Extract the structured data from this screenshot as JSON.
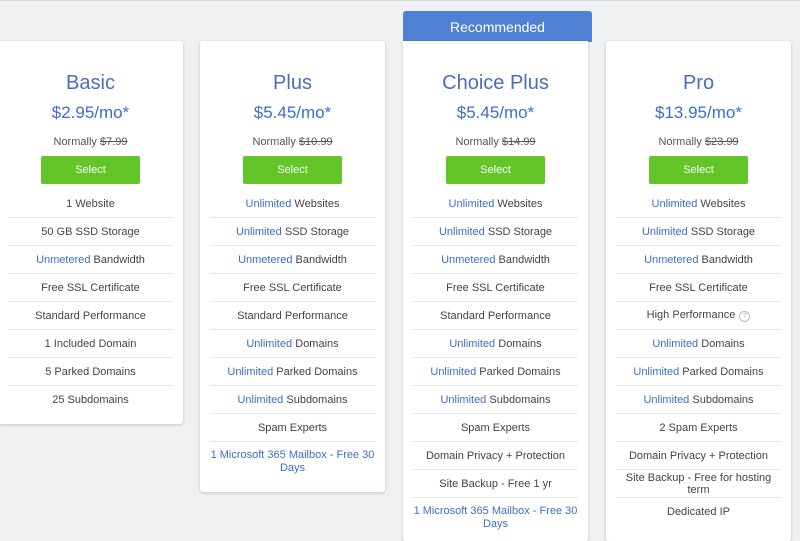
{
  "recommended_label": "Recommended",
  "plans": [
    {
      "name": "Basic",
      "price": "$2.95/mo*",
      "normally_label": "Normally",
      "normally_price": "$7.99",
      "select_label": "Select",
      "features": [
        {
          "hl": "",
          "text": "1 Website"
        },
        {
          "hl": "",
          "text": "50 GB SSD Storage"
        },
        {
          "hl": "Unmetered",
          "text": " Bandwidth"
        },
        {
          "hl": "",
          "text": "Free SSL Certificate"
        },
        {
          "hl": "",
          "text": "Standard Performance"
        },
        {
          "hl": "",
          "text": "1 Included Domain"
        },
        {
          "hl": "",
          "text": "5 Parked Domains"
        },
        {
          "hl": "",
          "text": "25 Subdomains"
        }
      ]
    },
    {
      "name": "Plus",
      "price": "$5.45/mo*",
      "normally_label": "Normally",
      "normally_price": "$10.99",
      "select_label": "Select",
      "features": [
        {
          "hl": "Unlimited",
          "text": " Websites"
        },
        {
          "hl": "Unlimited",
          "text": " SSD Storage"
        },
        {
          "hl": "Unmetered",
          "text": " Bandwidth"
        },
        {
          "hl": "",
          "text": "Free SSL Certificate"
        },
        {
          "hl": "",
          "text": "Standard Performance"
        },
        {
          "hl": "Unlimited",
          "text": " Domains"
        },
        {
          "hl": "Unlimited",
          "text": " Parked Domains"
        },
        {
          "hl": "Unlimited",
          "text": " Subdomains"
        },
        {
          "hl": "",
          "text": "Spam Experts"
        },
        {
          "hl": "1 Microsoft 365 Mailbox - Free 30 Days",
          "text": ""
        }
      ]
    },
    {
      "name": "Choice Plus",
      "price": "$5.45/mo*",
      "normally_label": "Normally",
      "normally_price": "$14.99",
      "select_label": "Select",
      "features": [
        {
          "hl": "Unlimited",
          "text": " Websites"
        },
        {
          "hl": "Unlimited",
          "text": " SSD Storage"
        },
        {
          "hl": "Unmetered",
          "text": " Bandwidth"
        },
        {
          "hl": "",
          "text": "Free SSL Certificate"
        },
        {
          "hl": "",
          "text": "Standard Performance"
        },
        {
          "hl": "Unlimited",
          "text": " Domains"
        },
        {
          "hl": "Unlimited",
          "text": " Parked Domains"
        },
        {
          "hl": "Unlimited",
          "text": " Subdomains"
        },
        {
          "hl": "",
          "text": "Spam Experts"
        },
        {
          "hl": "",
          "text": "Domain Privacy + Protection"
        },
        {
          "hl": "",
          "text": "Site Backup - Free 1 yr"
        },
        {
          "hl": "1 Microsoft 365 Mailbox - Free 30 Days",
          "text": ""
        }
      ]
    },
    {
      "name": "Pro",
      "price": "$13.95/mo*",
      "normally_label": "Normally",
      "normally_price": "$23.99",
      "select_label": "Select",
      "features": [
        {
          "hl": "Unlimited",
          "text": " Websites"
        },
        {
          "hl": "Unlimited",
          "text": " SSD Storage"
        },
        {
          "hl": "Unmetered",
          "text": " Bandwidth"
        },
        {
          "hl": "",
          "text": "Free SSL Certificate"
        },
        {
          "hl": "",
          "text": "High Performance",
          "help": "?"
        },
        {
          "hl": "Unlimited",
          "text": " Domains"
        },
        {
          "hl": "Unlimited",
          "text": " Parked Domains"
        },
        {
          "hl": "Unlimited",
          "text": " Subdomains"
        },
        {
          "hl": "",
          "text": "2 Spam Experts"
        },
        {
          "hl": "",
          "text": "Domain Privacy + Protection"
        },
        {
          "hl": "",
          "text": "Site Backup - Free for hosting term"
        },
        {
          "hl": "",
          "text": "Dedicated IP"
        }
      ]
    }
  ]
}
